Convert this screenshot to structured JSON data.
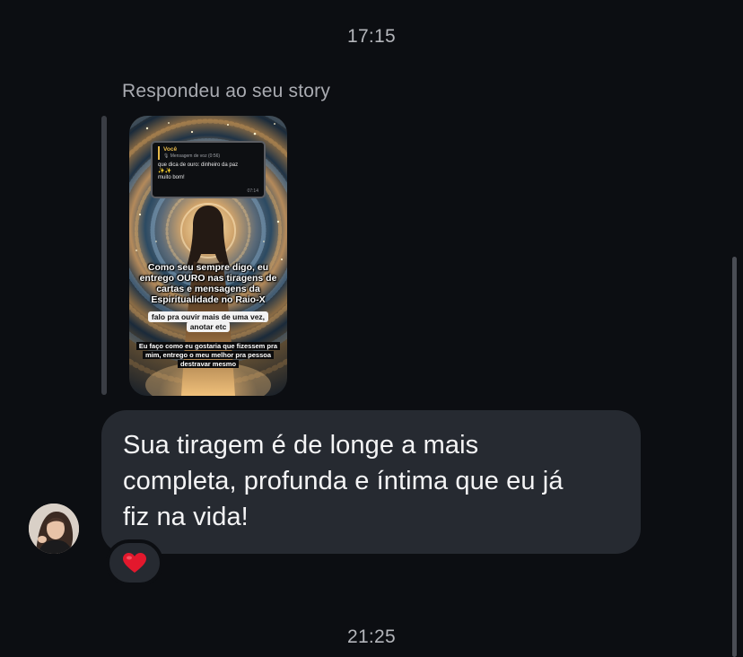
{
  "timestamps": {
    "top": "17:15",
    "bottom": "21:25"
  },
  "reply": {
    "caption": "Respondeu ao seu story"
  },
  "story": {
    "message_box": {
      "sender": "Você",
      "quoted_label": "🎙 Mensagem de voz (0:56)",
      "body_line1": "que dica de ouro: dinheiro da paz",
      "body_line2": "✨✨",
      "body_line3": "muito bom!",
      "time": "07:14"
    },
    "headline": "Como seu sempre digo, eu entrego OURO nas tiragens de cartas e mensagens da Espiritualidade no Raio-X",
    "pill": "falo pra ouvir mais de uma vez, anotar etc",
    "footer": "Eu faço como eu gostaria que fizessem pra mim, entrego o meu melhor pra pessoa destravar mesmo",
    "colors": {
      "gold": "#e7b94a",
      "glow": "#ffe7b0"
    }
  },
  "message": {
    "text": "Sua tiragem é de longe a mais\ncompleta, profunda e íntima que eu já\nfiz na vida!",
    "bubble_color": "#262a31",
    "text_color": "#f4f4f5"
  },
  "reaction": {
    "icon": "heart-icon",
    "color": "#e3182d"
  },
  "theme": {
    "background": "#0c0e12",
    "muted_text": "#b3b5ba"
  }
}
